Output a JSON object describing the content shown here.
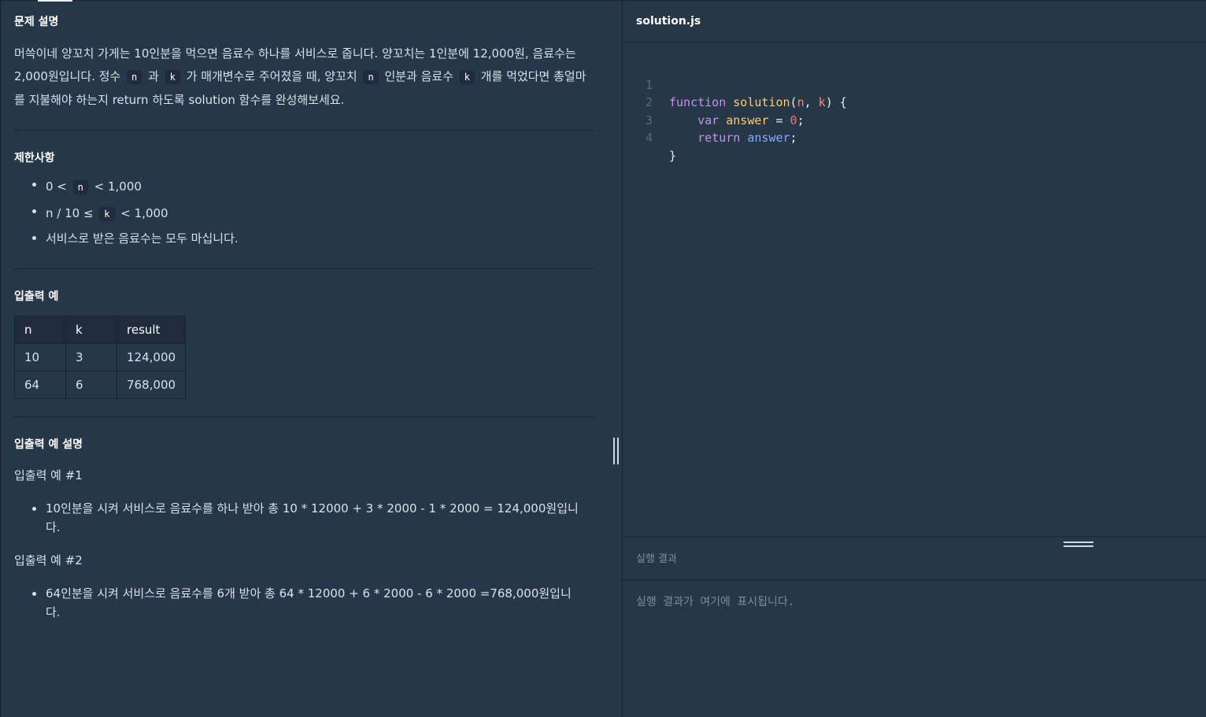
{
  "description": {
    "title": "문제 설명",
    "intro": {
      "t1": "머쓱이네 양꼬치 가게는 10인분을 먹으면 음료수 하나를 서비스로 줍니다. 양꼬치는 1인분에 12,000원, 음료수는 2,000원입니다. 정수 ",
      "c1": "n",
      "t2": " 과 ",
      "c2": "k",
      "t3": " 가 매개변수로 주어졌을 때, 양꼬치 ",
      "c3": "n",
      "t4": " 인분과 음료수 ",
      "c4": "k",
      "t5": " 개를 먹었다면 총얼마를 지불해야 하는지 return 하도록 solution 함수를 완성해보세요."
    }
  },
  "constraints": {
    "title": "제한사항",
    "item1": {
      "pre": "0 < ",
      "code": "n",
      "post": " < 1,000"
    },
    "item2": {
      "pre": "n / 10 ≤ ",
      "code": "k",
      "post": " < 1,000"
    },
    "item3": "서비스로 받은 음료수는 모두 마십니다."
  },
  "examples": {
    "title": "입출력 예",
    "headers": [
      "n",
      "k",
      "result"
    ],
    "rows": [
      [
        "10",
        "3",
        "124,000"
      ],
      [
        "64",
        "6",
        "768,000"
      ]
    ]
  },
  "explanation": {
    "title": "입출력 예 설명",
    "ex1_title": "입출력 예 #1",
    "ex1_text": "10인분을 시켜 서비스로 음료수를 하나 받아 총 10 * 12000 + 3 * 2000 - 1 * 2000 = 124,000원입니다.",
    "ex2_title": "입출력 예 #2",
    "ex2_text": "64인분을 시켜 서비스로 음료수를 6개 받아 총 64 * 12000 + 6 * 2000 - 6 * 2000 =768,000원입니다."
  },
  "editor": {
    "filename": "solution.js",
    "line_numbers": [
      "1",
      "2",
      "3",
      "4"
    ],
    "code": {
      "l1_kw": "function",
      "l1_fn": "solution",
      "l1_open": "(",
      "l1_p1": "n",
      "l1_comma": ", ",
      "l1_p2": "k",
      "l1_close": ") {",
      "l2_kw": "var",
      "l2_name": "answer",
      "l2_eq": " = ",
      "l2_num": "0",
      "l2_end": ";",
      "l3_kw": "return",
      "l3_name": "answer",
      "l3_end": ";",
      "l4": "}"
    }
  },
  "result": {
    "title": "실행 결과",
    "placeholder": "실행 결과가 여기에 표시됩니다."
  },
  "colors": {
    "background": "#263747",
    "border": "#172334",
    "keyword": "#c792ea",
    "function": "#ffcb6b",
    "number": "#f07178"
  }
}
